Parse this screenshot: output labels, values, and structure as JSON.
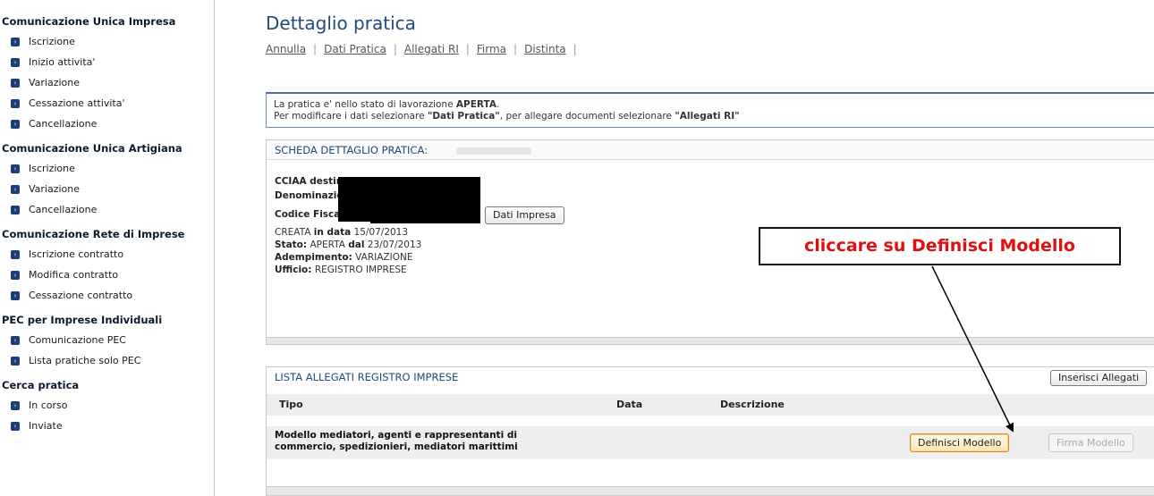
{
  "sidebar": {
    "sections": [
      {
        "title": "Comunicazione Unica Impresa",
        "items": [
          "Iscrizione",
          "Inizio attivita'",
          "Variazione",
          "Cessazione attivita'",
          "Cancellazione"
        ]
      },
      {
        "title": "Comunicazione Unica Artigiana",
        "items": [
          "Iscrizione",
          "Variazione",
          "Cancellazione"
        ]
      },
      {
        "title": "Comunicazione Rete di Imprese",
        "items": [
          "Iscrizione contratto",
          "Modifica contratto",
          "Cessazione contratto"
        ]
      },
      {
        "title": "PEC per Imprese Individuali",
        "items": [
          "Comunicazione PEC",
          "Lista pratiche solo PEC"
        ]
      },
      {
        "title": "Cerca pratica",
        "items": [
          "In corso",
          "Inviate"
        ]
      }
    ]
  },
  "page": {
    "title": "Dettaglio pratica",
    "nav": [
      "Annulla",
      "Dati Pratica",
      "Allegati RI",
      "Firma",
      "Distinta"
    ],
    "nav_sep": "|"
  },
  "info": {
    "line1_prefix": "La pratica e' nello stato di lavorazione ",
    "line1_state": "APERTA",
    "line1_suffix": ".",
    "line2_prefix": "Per modificare i dati selezionare ",
    "line2_a": "\"Dati Pratica\"",
    "line2_mid": ", per allegare documenti selezionare ",
    "line2_b": "\"Allegati RI\""
  },
  "scheda": {
    "header": "SCHEDA DETTAGLIO PRATICA:",
    "cciaa_label": "CCIAA destinat",
    "denominazione_label": "Denominazione",
    "cf_label": "Codice Fiscale:",
    "dati_impresa_button": "Dati Impresa",
    "creata_prefix": "CREATA ",
    "creata_label": "in data",
    "creata_value": " 15/07/2013",
    "stato_label": "Stato:",
    "stato_value": " APERTA ",
    "stato_dal_label": "dal",
    "stato_dal_value": " 23/07/2013",
    "adempimento_label": "Adempimento:",
    "adempimento_value": " VARIAZIONE",
    "ufficio_label": "Ufficio:",
    "ufficio_value": " REGISTRO IMPRESE"
  },
  "allegati": {
    "header": "LISTA ALLEGATI REGISTRO IMPRESE",
    "inserisci_button": "Inserisci Allegati",
    "columns": {
      "tipo": "Tipo",
      "data": "Data",
      "descrizione": "Descrizione"
    },
    "row": {
      "tipo_line1": "Modello mediatori, agenti e rappresentanti di",
      "tipo_line2": "commercio, spedizionieri, mediatori marittimi",
      "definisci_button": "Definisci Modello",
      "firma_button": "Firma Modello"
    }
  },
  "callout": {
    "text": "cliccare su Definisci Modello",
    "color": "#e01010"
  },
  "colors": {
    "accent": "#1f4a7a",
    "nav_bullet": "#1d3f78"
  }
}
